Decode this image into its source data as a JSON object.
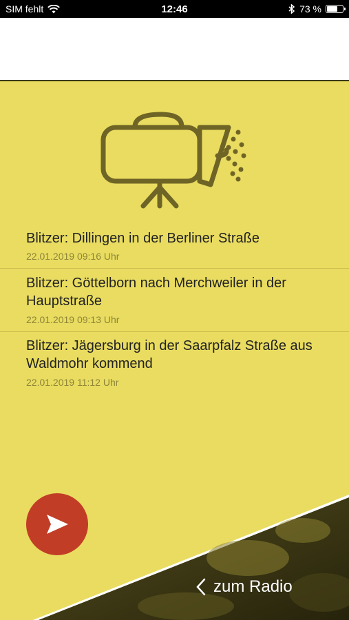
{
  "status_bar": {
    "carrier": "SIM fehlt",
    "time": "12:46",
    "battery_percent": "73 %",
    "battery_level": 0.73,
    "icons": [
      "wifi-icon",
      "bluetooth-icon",
      "battery-icon"
    ]
  },
  "news": [
    {
      "title": "Blitzer: Dillingen in der Berliner Straße",
      "date": "22.01.2019 09:16 Uhr"
    },
    {
      "title": "Blitzer: Göttelborn nach Merchweiler in der Hauptstraße",
      "date": "22.01.2019 09:13 Uhr"
    },
    {
      "title": "Blitzer: Jägersburg in der Saarpfalz Straße aus Waldmohr kommend",
      "date": "22.01.2019 11:12 Uhr"
    }
  ],
  "footer": {
    "radio_label": "zum Radio",
    "play_icon": "play-icon",
    "back_icon": "chevron-left-icon"
  },
  "colors": {
    "background": "#e9dc60",
    "play_button": "#c23d26",
    "icon": "#6e6426"
  }
}
